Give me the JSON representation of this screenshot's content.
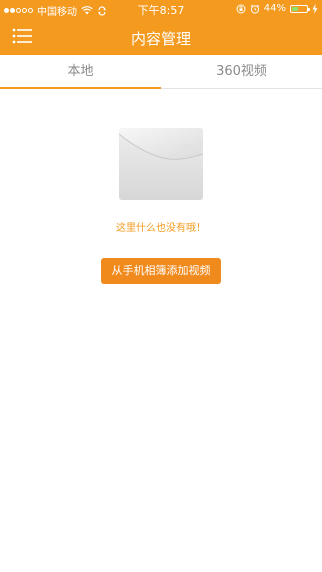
{
  "status_bar": {
    "carrier": "中国移动",
    "time": "下午8:57",
    "battery_percent": "44%",
    "battery_level": 0.44,
    "icons": [
      "signal-icon",
      "wifi-icon",
      "sync-icon",
      "lock-rotation-icon",
      "alarm-icon",
      "battery-icon",
      "charging-icon"
    ]
  },
  "nav": {
    "title": "内容管理",
    "menu_icon": "menu-icon"
  },
  "tabs": [
    {
      "label": "本地",
      "selected": true
    },
    {
      "label": "360视频",
      "selected": false
    }
  ],
  "empty_state": {
    "message": "这里什么也没有哦！",
    "icon": "envelope-icon"
  },
  "actions": {
    "add_button_label": "从手机相簿添加视频"
  },
  "colors": {
    "accent": "#f39a1f",
    "button": "#f08a1d",
    "battery_fill": "#8be36b"
  }
}
